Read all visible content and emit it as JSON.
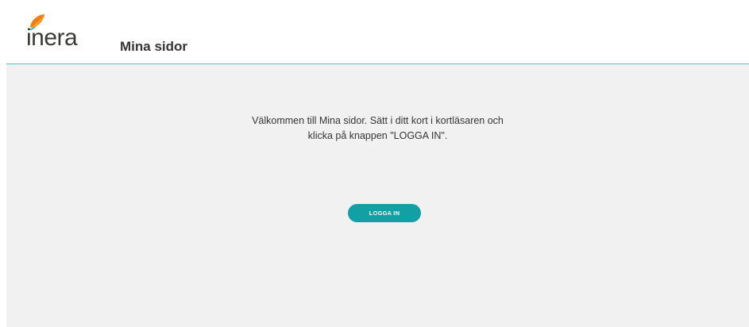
{
  "header": {
    "logo_text": "inera",
    "app_title": "Mina sidor"
  },
  "main": {
    "welcome_line1": "Välkommen till Mina sidor. Sätt i ditt kort i kortläsaren och",
    "welcome_line2": "klicka på knappen \"LOGGA IN\".",
    "login_button_label": "LOGGA IN"
  },
  "colors": {
    "accent": "#12a0a4",
    "header_rule": "#4cb8c0",
    "content_background": "#f1f1f1",
    "logo_mark_orange": "#f07c1a",
    "logo_mark_blue": "#1e98c9"
  },
  "icons": {
    "logo_mark": "inera-leaf-logo-icon"
  }
}
